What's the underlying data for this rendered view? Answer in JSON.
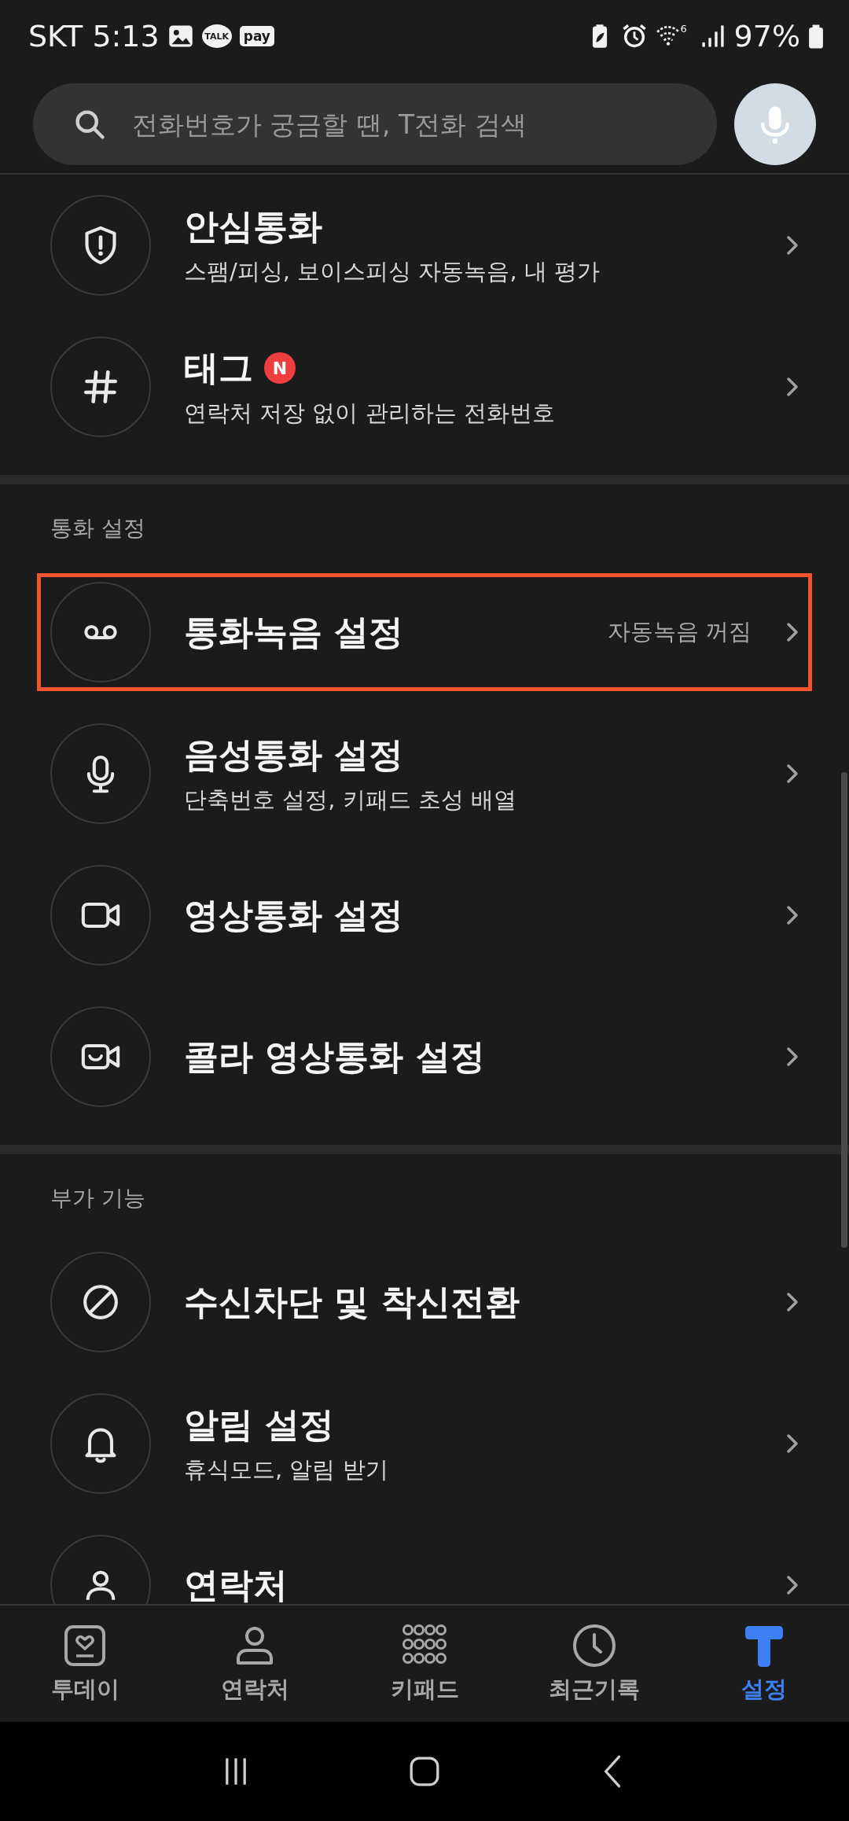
{
  "status_bar": {
    "carrier_time": "SKT 5:13",
    "talk_label": "TALK",
    "pay_label": "pay",
    "wifi_label": "6",
    "battery": "97%"
  },
  "search": {
    "placeholder": "전화번호가 궁금할 땐, T전화 검색"
  },
  "sections": [
    {
      "items": [
        {
          "kind": "shield",
          "title": "안심통화",
          "subtitle": "스팸/피싱, 보이스피싱 자동녹음, 내 평가",
          "highlighted": false
        },
        {
          "kind": "hash",
          "title": "태그",
          "badge": "N",
          "subtitle": "연락처 저장 없이 관리하는 전화번호",
          "highlighted": false
        }
      ]
    },
    {
      "header": "통화 설정",
      "items": [
        {
          "kind": "voicemail",
          "title": "통화녹음 설정",
          "value": "자동녹음 꺼짐",
          "highlighted": true
        },
        {
          "kind": "mic",
          "title": "음성통화 설정",
          "subtitle": "단축번호 설정, 키패드 초성 배열",
          "highlighted": false
        },
        {
          "kind": "video",
          "title": "영상통화 설정",
          "highlighted": false
        },
        {
          "kind": "video-smile",
          "title": "콜라 영상통화 설정",
          "highlighted": false
        }
      ]
    },
    {
      "header": "부가 기능",
      "items": [
        {
          "kind": "block",
          "title": "수신차단 및 착신전환",
          "highlighted": false
        },
        {
          "kind": "bell",
          "title": "알림 설정",
          "subtitle": "휴식모드, 알림 받기",
          "highlighted": false
        },
        {
          "kind": "person",
          "title": "연락처",
          "highlighted": false
        }
      ]
    }
  ],
  "tabs": [
    {
      "kind": "today",
      "label": "투데이",
      "selected": false
    },
    {
      "kind": "contacts",
      "label": "연락처",
      "selected": false
    },
    {
      "kind": "keypad",
      "label": "키패드",
      "selected": false
    },
    {
      "kind": "recent",
      "label": "최근기록",
      "selected": false
    },
    {
      "kind": "t",
      "label": "설정",
      "selected": true
    }
  ]
}
